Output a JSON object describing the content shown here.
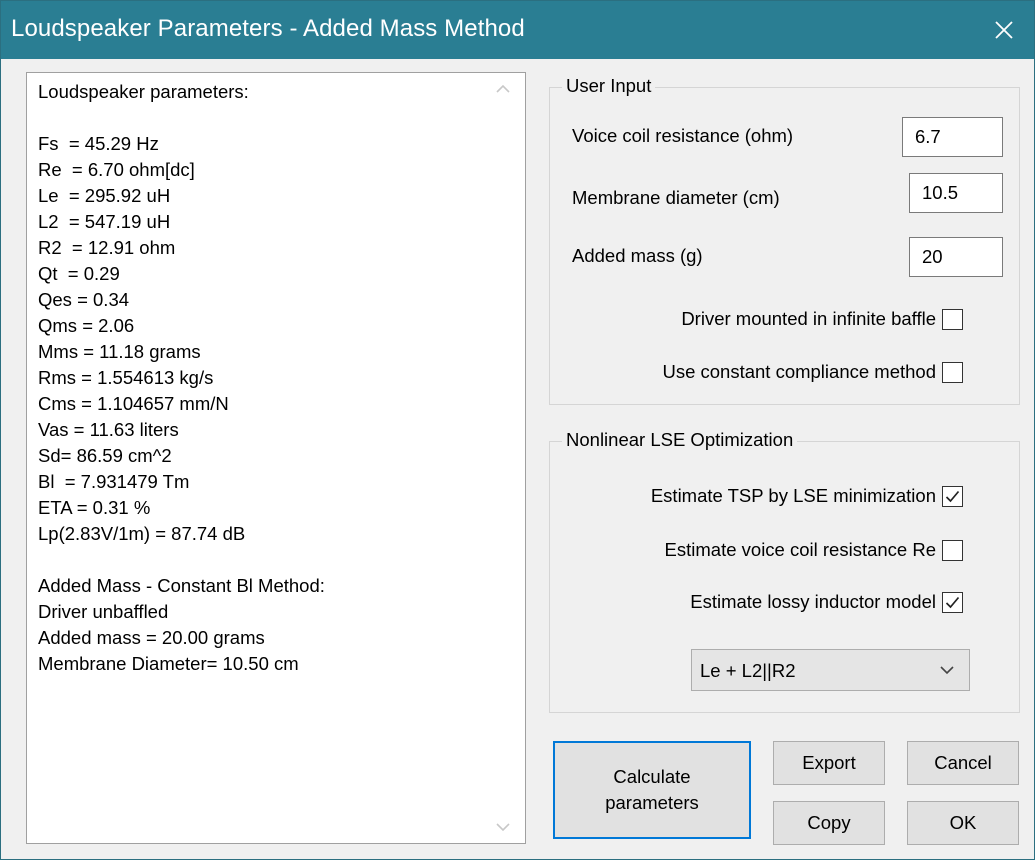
{
  "window": {
    "title": "Loudspeaker Parameters - Added Mass Method"
  },
  "output": {
    "lines": [
      "Loudspeaker parameters:",
      "",
      "Fs  = 45.29 Hz",
      "Re  = 6.70 ohm[dc]",
      "Le  = 295.92 uH",
      "L2  = 547.19 uH",
      "R2  = 12.91 ohm",
      "Qt  = 0.29",
      "Qes = 0.34",
      "Qms = 2.06",
      "Mms = 11.18 grams",
      "Rms = 1.554613 kg/s",
      "Cms = 1.104657 mm/N",
      "Vas = 11.63 liters",
      "Sd= 86.59 cm^2",
      "Bl  = 7.931479 Tm",
      "ETA = 0.31 %",
      "Lp(2.83V/1m) = 87.74 dB",
      "",
      "Added Mass - Constant Bl Method:",
      "Driver unbaffled",
      "Added mass = 20.00 grams",
      "Membrane Diameter= 10.50 cm"
    ]
  },
  "user_input": {
    "caption": "User Input",
    "voice_coil_label": "Voice coil resistance (ohm)",
    "voice_coil_value": "6.7",
    "membrane_label": "Membrane diameter (cm)",
    "membrane_value": "10.5",
    "added_mass_label": "Added mass (g)",
    "added_mass_value": "20",
    "infinite_baffle_label": "Driver mounted in infinite baffle",
    "infinite_baffle_checked": false,
    "constant_compliance_label": "Use constant compliance method",
    "constant_compliance_checked": false
  },
  "lse": {
    "caption": "Nonlinear LSE Optimization",
    "estimate_tsp_label": "Estimate TSP by LSE minimization",
    "estimate_tsp_checked": true,
    "estimate_re_label": "Estimate voice coil resistance Re",
    "estimate_re_checked": false,
    "lossy_inductor_label": "Estimate lossy inductor model",
    "lossy_inductor_checked": true,
    "model_selected": "Le + L2||R2"
  },
  "buttons": {
    "calculate": "Calculate\nparameters",
    "export": "Export",
    "cancel": "Cancel",
    "copy": "Copy",
    "ok": "OK"
  },
  "icons": {
    "close": "close-icon",
    "scroll_up": "scroll-up-icon",
    "scroll_down": "scroll-down-icon",
    "checkmark": "checkmark-icon",
    "chevron": "chevron-down-icon"
  },
  "colors": {
    "titlebar": "#2a7e93",
    "window_bg": "#f0f0f0",
    "primary_focus": "#0078d7"
  }
}
